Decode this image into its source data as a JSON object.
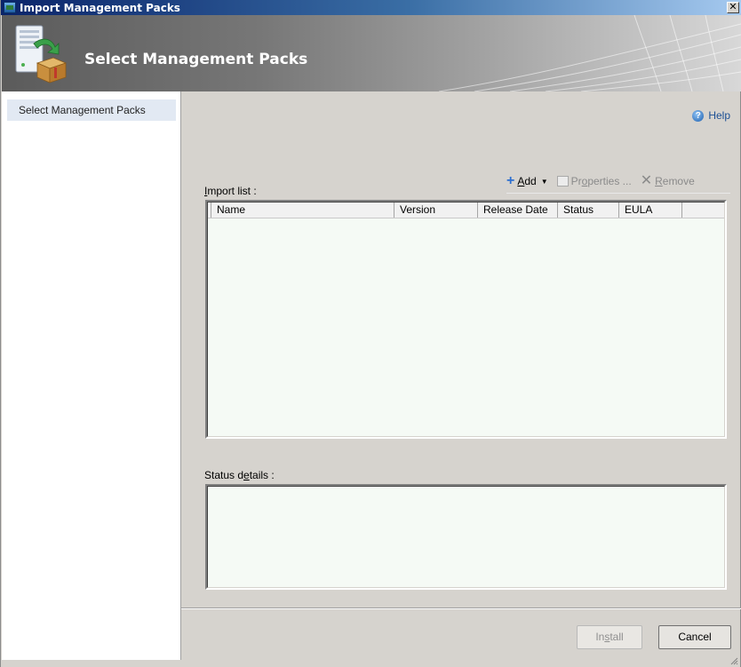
{
  "window": {
    "title": "Import Management Packs",
    "close_glyph": "✕"
  },
  "banner": {
    "title": "Select Management Packs",
    "icon": "server-box-icon"
  },
  "nav": {
    "items": [
      {
        "label": "Select Management Packs",
        "selected": true
      }
    ]
  },
  "help": {
    "label": "Help",
    "icon_glyph": "?"
  },
  "import_list": {
    "label_prefix": "",
    "label_underlined": "I",
    "label_rest": "mport list :",
    "toolbar": {
      "add": {
        "underlined": "A",
        "rest": "dd",
        "enabled": true,
        "icon": "plus-icon"
      },
      "properties": {
        "prefix": "Pr",
        "underlined": "o",
        "rest": "perties ...",
        "enabled": false,
        "icon": "properties-icon"
      },
      "remove": {
        "underlined": "R",
        "rest": "emove",
        "enabled": false,
        "icon": "x-icon"
      }
    },
    "columns": [
      "Name",
      "Version",
      "Release Date",
      "Status",
      "EULA"
    ],
    "rows": []
  },
  "status_details": {
    "label_prefix": "Status d",
    "label_underlined": "e",
    "label_rest": "tails :"
  },
  "buttons": {
    "install": {
      "prefix": "In",
      "underlined": "s",
      "rest": "tall",
      "enabled": false
    },
    "cancel": {
      "label": "Cancel",
      "enabled": true
    }
  },
  "colors": {
    "title_bar_start": "#0a246a",
    "nav_selected": "#e2e9f3",
    "list_background": "#f5faf5",
    "dialog_face": "#d6d3ce"
  }
}
